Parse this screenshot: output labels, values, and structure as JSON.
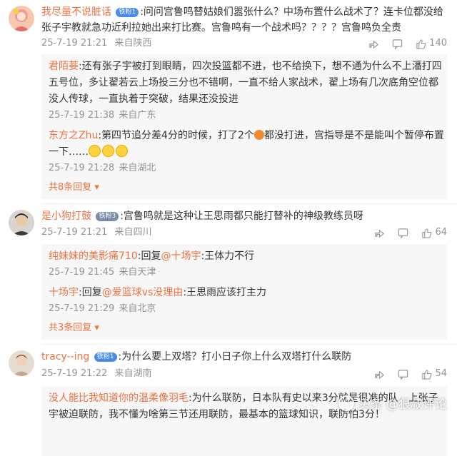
{
  "comments": [
    {
      "user": "我尽量不说脏话",
      "badge": "铁粉1",
      "text": "问问宫鲁鸣替姑娘们嚣张什么？中场布置什么战术了？连卡位都没给张子宇教就急功近利拉她出来打比赛。宫鲁鸣有一个战术吗？？？？宫鲁鸣负全责",
      "time": "25-7-19 21:21",
      "location": "来自陕西",
      "likes": "140",
      "replies": [
        {
          "user": "君陌菨",
          "text": "还有张子宇被打到眼睛，四次投篮都不进，也不给换下，想不通为什么不上潘打四五号位，多让翟若云上场投三分也不错啊，一直不给人家战术，翟上场有几次底角空位都没人传球，一直执着于突破，结果还没投进",
          "time": "25-7-19 21:38",
          "location": "来自广东"
        },
        {
          "user": "东方之Zhu",
          "text": "第四节追分差4分的时候，打了2个",
          "text_after": "都没打进，宫指导是不是能叫个暂停布置一下……",
          "time": "25-7-19 21:28",
          "location": "来自湖北"
        }
      ],
      "more": "共8条回复"
    },
    {
      "user": "是小狗打鼓",
      "badge": "铁粉3",
      "text": "宫鲁鸣就是这种让王思雨都只能打替补的神级教练员呀",
      "time": "25-7-19 21:21",
      "location": "来自四川",
      "likes": "64",
      "replies": [
        {
          "user": "纯妹妹的美影痛710",
          "text_prefix": "回复",
          "mention": "@十场宇",
          "text": "王体力不行",
          "time": "25-7-19 21:45",
          "location": "来自天津"
        },
        {
          "user": "十场宇",
          "text_prefix": "回复",
          "mention": "@爱篮球vs没理由",
          "text": "王思雨应该打主力",
          "time": "25-7-19 21:29",
          "location": "来自北京"
        }
      ],
      "more": "共3条回复"
    },
    {
      "user": "tracy--ing",
      "badge": "铁粉1",
      "text": "为什么要上双塔？打小日子你上什么双塔打什么联防",
      "time": "25-7-19 21:22",
      "location": "来自湖南",
      "likes": "54",
      "replies": [
        {
          "user": "没人能比我知道你的温柔像羽毛",
          "text": "为什么联防，日本队有史以来3分就是很准的队，上张子宇被迫联防，我不懂为啥第三节还用联防，最基本的篮球知识，联防怕3分！"
        }
      ]
    }
  ],
  "watermark": "头条 @狠叔评论",
  "colors": {
    "username": "#eb7340",
    "badge": "#4a8de6",
    "meta": "#939393"
  }
}
